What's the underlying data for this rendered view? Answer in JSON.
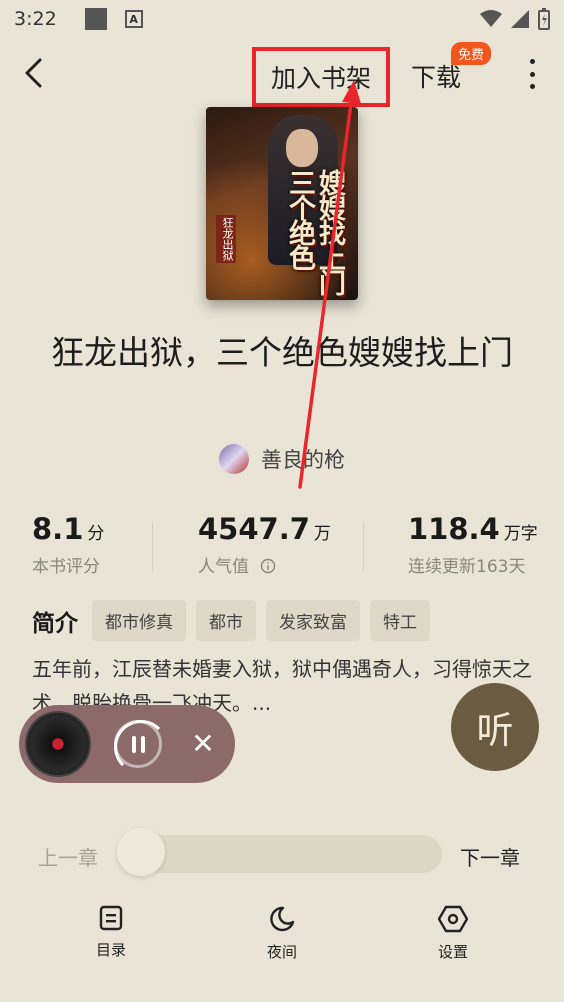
{
  "status": {
    "time": "3:22"
  },
  "header": {
    "add_to_shelf": "加入书架",
    "download": "下载",
    "free_badge": "免费"
  },
  "book": {
    "cover": {
      "title_text": "嫂嫂找上门 三个绝色",
      "series_text": "狂龙出狱",
      "author_small": "善良的枪"
    },
    "title": "狂龙出狱，三个绝色嫂嫂找上门",
    "author": "善良的枪"
  },
  "stats": [
    {
      "value": "8.1",
      "unit": "分",
      "label": "本书评分"
    },
    {
      "value": "4547.7",
      "unit": "万",
      "label": "人气值"
    },
    {
      "value": "118.4",
      "unit": "万字",
      "label": "连续更新163天"
    }
  ],
  "intro": {
    "heading": "简介",
    "tags": [
      "都市修真",
      "都市",
      "发家致富",
      "特工"
    ],
    "summary": "五年前，江辰替未婚妻入狱，狱中偶遇奇人，习得惊天之术，脱胎换骨一飞冲天。..."
  },
  "listen_button": "听",
  "progress": {
    "prev": "上一章",
    "next": "下一章",
    "position": 0.0
  },
  "bottom_nav": [
    {
      "label": "目录",
      "icon": "list-icon"
    },
    {
      "label": "夜间",
      "icon": "moon-icon"
    },
    {
      "label": "设置",
      "icon": "settings-hexagon-icon"
    }
  ],
  "colors": {
    "background": "#e9e4d5",
    "highlight": "#e8262b",
    "badge": "#f2561d",
    "listen": "#6b5b40",
    "player": "#8c6a6a"
  }
}
